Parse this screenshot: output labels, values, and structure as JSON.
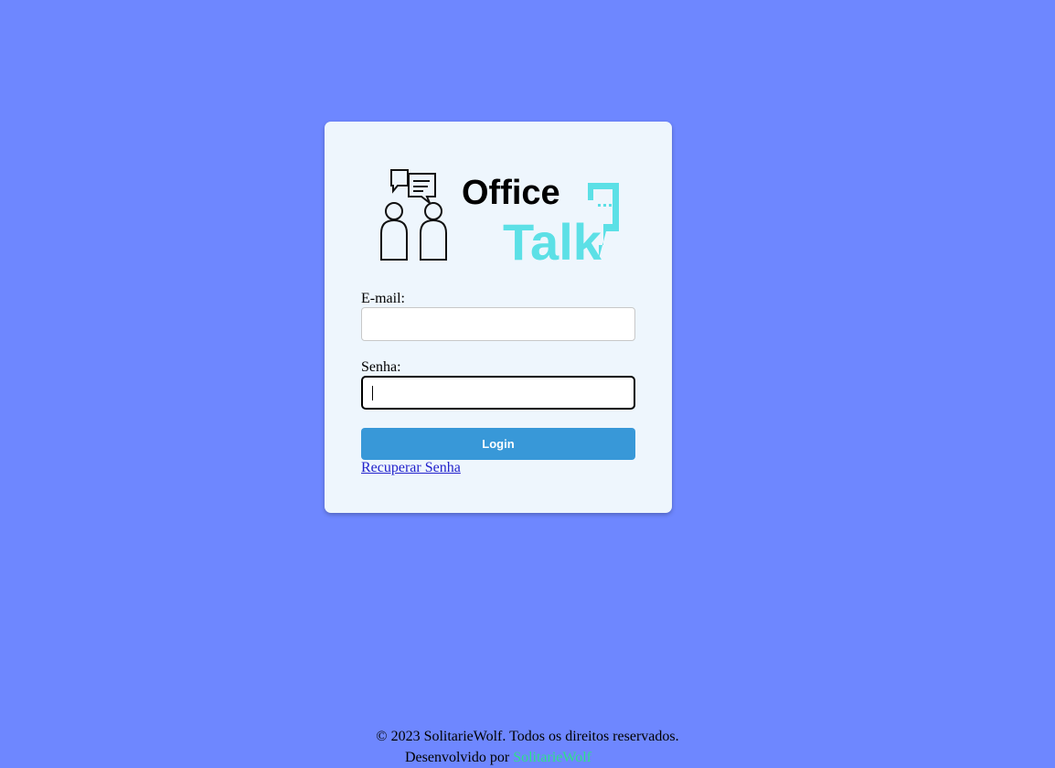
{
  "login": {
    "logo": {
      "office": "Office",
      "talk": "Talk"
    },
    "email_label": "E-mail:",
    "email_value": "",
    "password_label": "Senha:",
    "password_value": "",
    "login_button": "Login",
    "recover_link": "Recuperar Senha"
  },
  "footer": {
    "copyright": "© 2023 SolitarieWolf. Todos os direitos reservados.",
    "developed_by": "Desenvolvido por",
    "developer": "SolitarieWolf"
  },
  "colors": {
    "background": "#6e87ff",
    "card": "#eef6fd",
    "button": "#3898d8",
    "logo_accent": "#5ce0e6",
    "developer_link": "#2ee08a"
  }
}
